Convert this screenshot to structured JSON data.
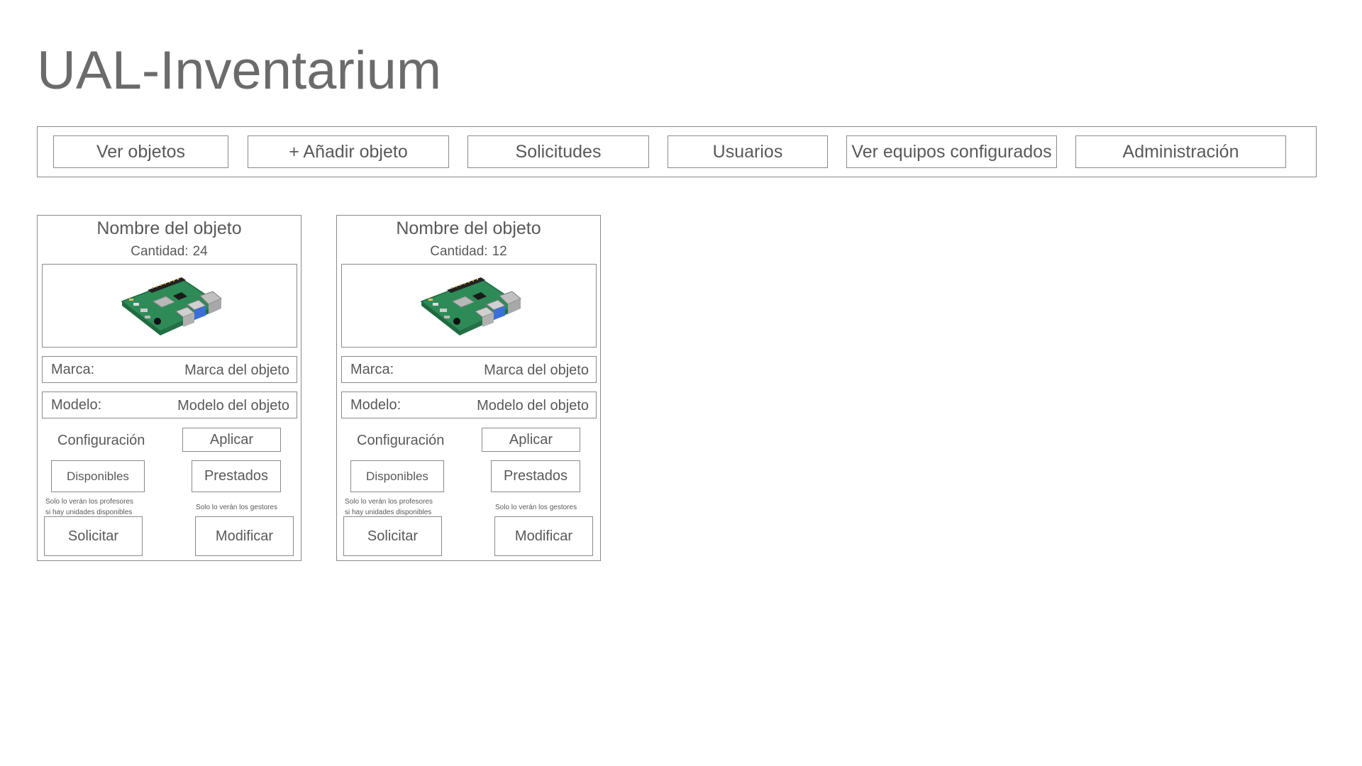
{
  "app": {
    "title": "UAL-Inventarium"
  },
  "nav": {
    "items": [
      {
        "label": "Ver objetos"
      },
      {
        "label": "+ Añadir objeto"
      },
      {
        "label": "Solicitudes"
      },
      {
        "label": "Usuarios"
      },
      {
        "label": "Ver equipos configurados"
      },
      {
        "label": "Administración"
      }
    ]
  },
  "cards": [
    {
      "name": "Nombre del objeto",
      "quantity_label": "Cantidad:",
      "quantity": "24",
      "image_icon": "raspberry-pi-board",
      "brand_label": "Marca:",
      "brand_value": "Marca del objeto",
      "model_label": "Modelo:",
      "model_value": "Modelo del objeto",
      "config_label": "Configuración",
      "apply_label": "Aplicar",
      "available_label": "Disponibles",
      "borrowed_label": "Prestados",
      "note_teachers_line1": "Solo lo verán los profesores",
      "note_teachers_line2": "si hay unidades disponibles",
      "note_managers": "Solo lo verán los gestores",
      "request_label": "Solicitar",
      "modify_label": "Modificar"
    },
    {
      "name": "Nombre del objeto",
      "quantity_label": "Cantidad:",
      "quantity": "12",
      "image_icon": "raspberry-pi-board",
      "brand_label": "Marca:",
      "brand_value": "Marca del objeto",
      "model_label": "Modelo:",
      "model_value": "Modelo del objeto",
      "config_label": "Configuración",
      "apply_label": "Aplicar",
      "available_label": "Disponibles",
      "borrowed_label": "Prestados",
      "note_teachers_line1": "Solo lo verán los profesores",
      "note_teachers_line2": "si hay unidades disponibles",
      "note_managers": "Solo lo verán los gestores",
      "request_label": "Solicitar",
      "modify_label": "Modificar"
    }
  ],
  "colors": {
    "text": "#595959",
    "border": "#8a8a8a",
    "board_green": "#2e8b57"
  }
}
